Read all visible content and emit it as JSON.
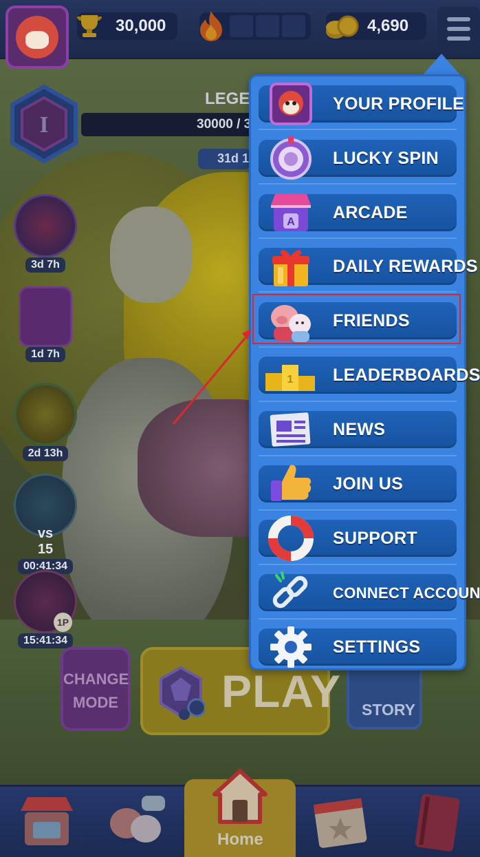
{
  "topbar": {
    "trophies": "30,000",
    "coins": "4,690"
  },
  "rank": {
    "tier_letter": "I",
    "label": "LEGEN",
    "progress_text": "30000 / 3",
    "timer": "31d 1"
  },
  "events": [
    {
      "icon": "rocket-event-icon",
      "timer": "3d 7h"
    },
    {
      "icon": "arcade-console-event-icon",
      "timer": "1d 7h"
    },
    {
      "icon": "compass-event-icon",
      "timer": "2d 13h"
    },
    {
      "icon": "toilet-event-icon",
      "timer": "vs 15",
      "timer2": "00:41:34"
    },
    {
      "icon": "dna-event-icon",
      "badge": "1P",
      "timer": "15:41:34"
    }
  ],
  "play_area": {
    "change_mode_line1": "CHANGE",
    "change_mode_line2": "MODE",
    "play_label": "PLAY",
    "story_label": "STORY"
  },
  "bottom_nav": {
    "home_label": "Home"
  },
  "menu": {
    "items": [
      {
        "label": "YOUR PROFILE",
        "icon": "profile-avatar-icon"
      },
      {
        "label": "LUCKY SPIN",
        "icon": "lucky-spin-wheel-icon"
      },
      {
        "label": "ARCADE",
        "icon": "arcade-shop-icon"
      },
      {
        "label": "DAILY REWARDS",
        "icon": "gift-box-icon"
      },
      {
        "label": "FRIENDS",
        "icon": "friends-icon"
      },
      {
        "label": "LEADERBOARDS",
        "icon": "podium-icon"
      },
      {
        "label": "NEWS",
        "icon": "newspaper-icon"
      },
      {
        "label": "JOIN US",
        "icon": "thumbs-up-icon"
      },
      {
        "label": "SUPPORT",
        "icon": "lifebuoy-icon"
      },
      {
        "label": "CONNECT ACCOUNT",
        "icon": "link-icon"
      },
      {
        "label": "SETTINGS",
        "icon": "gear-icon"
      }
    ]
  },
  "colors": {
    "menu_panel": "#3a83e0",
    "menu_item": "#1f62b8",
    "highlight": "#d9272e"
  }
}
